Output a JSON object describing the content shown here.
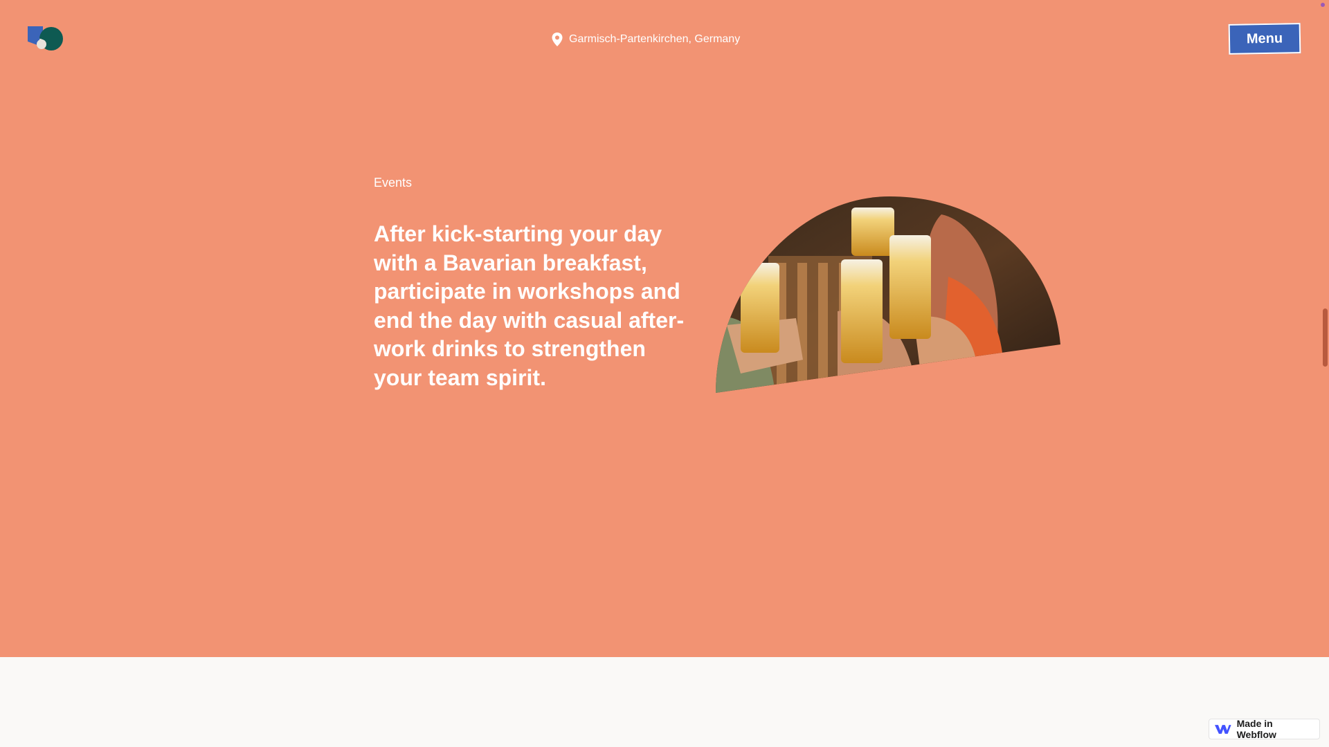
{
  "header": {
    "logo_icon": "brand-logo-icon",
    "location": {
      "icon": "map-pin-icon",
      "text": "Garmisch-Partenkirchen, Germany"
    },
    "menu_label": "Menu"
  },
  "section": {
    "label": "Events",
    "lead": "After kick-starting your day with a Bavarian breakfast, participate in workshops and end the day with casual after-work drinks to strengthen your team spirit.",
    "image_icon": "people-toasting-beer-photo"
  },
  "badge": {
    "icon": "webflow-logo-icon",
    "label": "Made in Webflow"
  },
  "colors": {
    "hero_background": "#f29373",
    "page_background": "#faf9f7",
    "menu_button": "#3b64b9",
    "text_on_hero": "#ffffff"
  }
}
